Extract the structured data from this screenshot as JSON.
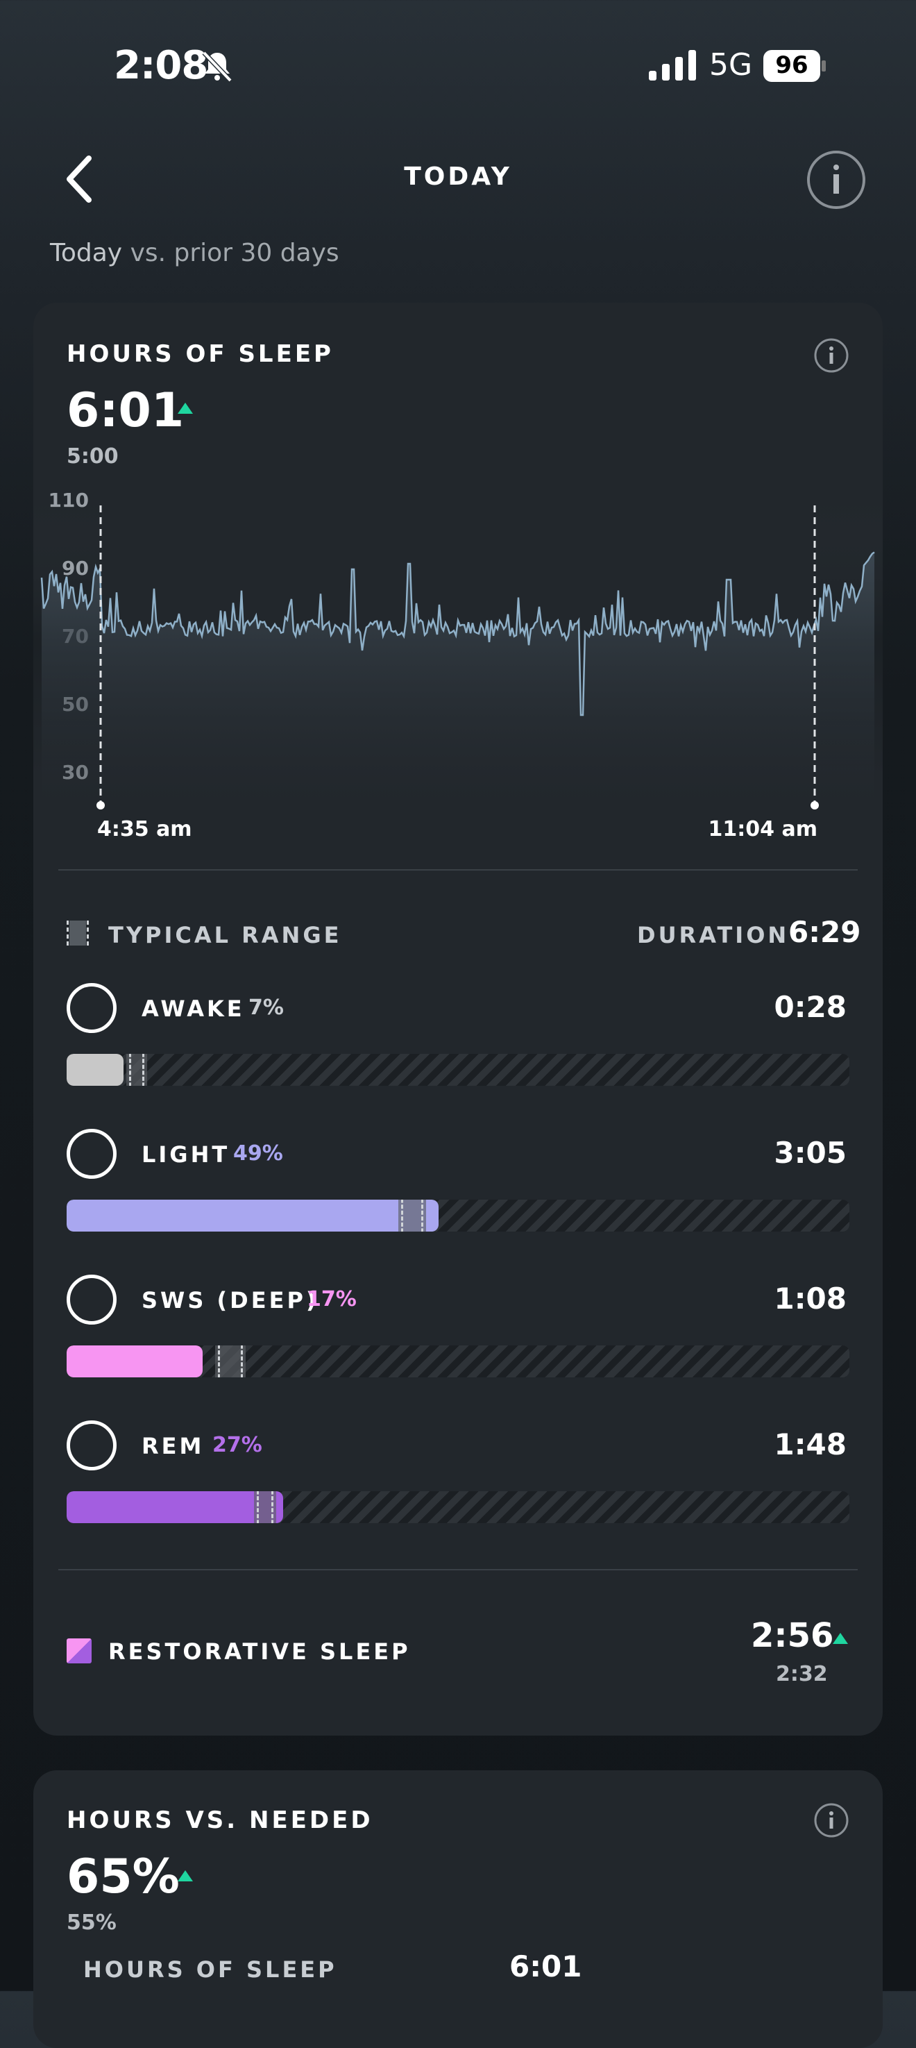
{
  "status_bar": {
    "time": "2:08",
    "network": "5G",
    "battery": "96"
  },
  "header": {
    "title": "TODAY",
    "subtitle_prefix": "Today",
    "subtitle_rest": "vs. prior 30 days"
  },
  "hours_of_sleep": {
    "title": "HOURS OF SLEEP",
    "value": "6:01",
    "baseline": "5:00",
    "chart": {
      "y_ticks": [
        "110",
        "90",
        "70",
        "50",
        "30"
      ],
      "start_label": "4:35 am",
      "end_label": "11:04 am"
    }
  },
  "stages": {
    "typical_range_label": "TYPICAL RANGE",
    "duration_label": "DURATION",
    "duration_value": "6:29",
    "items": [
      {
        "name": "AWAKE",
        "pct": "7%",
        "time": "0:28",
        "color": "#c8c8c8",
        "pct_color": "#c8cdd2"
      },
      {
        "name": "LIGHT",
        "pct": "49%",
        "time": "3:05",
        "color": "#a9a7f0",
        "pct_color": "#a9a7f0"
      },
      {
        "name": "SWS (DEEP)",
        "pct": "17%",
        "time": "1:08",
        "color": "#f795f2",
        "pct_color": "#f795f2"
      },
      {
        "name": "REM",
        "pct": "27%",
        "time": "1:48",
        "color": "#a35ee0",
        "pct_color": "#b470ea"
      }
    ]
  },
  "restorative": {
    "label": "RESTORATIVE SLEEP",
    "value": "2:56",
    "baseline": "2:32"
  },
  "hours_vs_needed": {
    "title": "HOURS VS. NEEDED",
    "value": "65%",
    "baseline": "55%",
    "row_label": "HOURS OF SLEEP",
    "row_value": "6:01"
  },
  "colors": {
    "accent_up": "#1fd6a0",
    "card": "#22272c",
    "chart_line": "#8fb0c8"
  }
}
